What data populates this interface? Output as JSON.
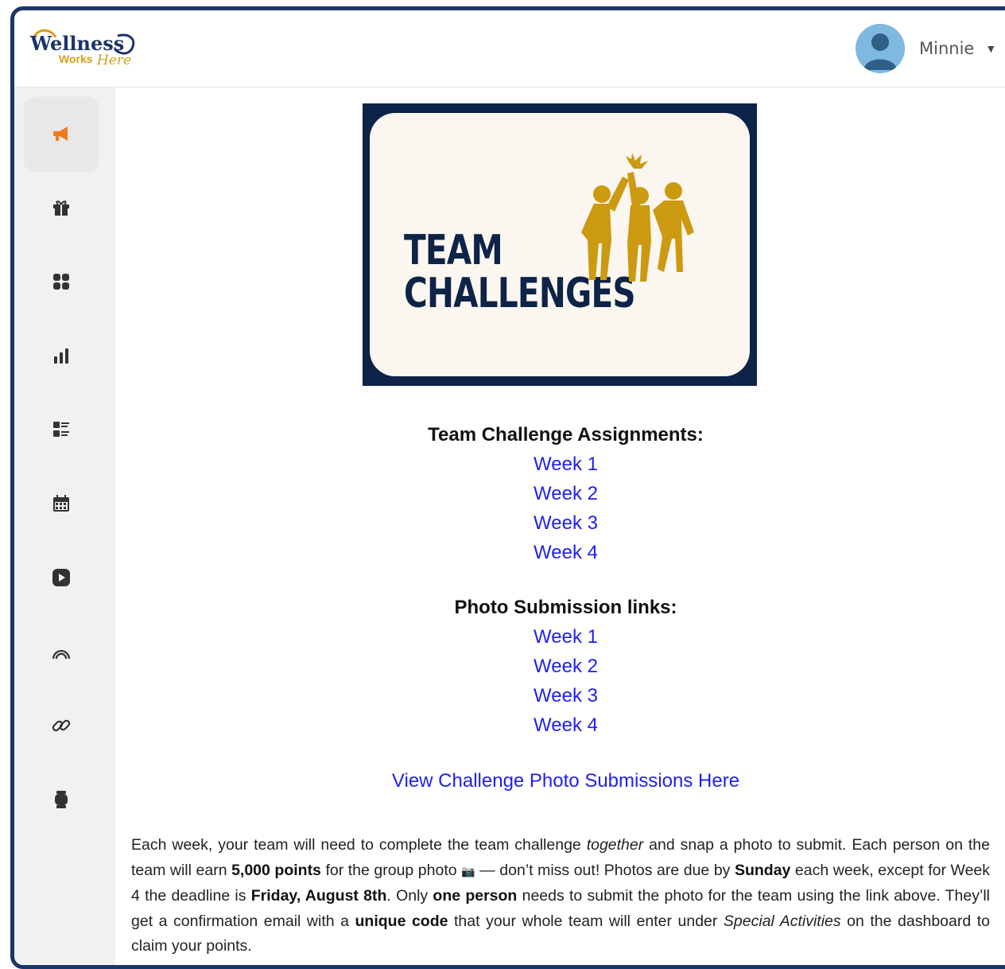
{
  "header": {
    "logo_text": "Wellness Works Here",
    "user_name": "Minnie",
    "caret": "▼"
  },
  "sidebar": {
    "items": [
      {
        "icon": "megaphone-icon",
        "active": true
      },
      {
        "icon": "gift-icon",
        "active": false
      },
      {
        "icon": "apps-grid-icon",
        "active": false
      },
      {
        "icon": "bar-chart-icon",
        "active": false
      },
      {
        "icon": "list-icon",
        "active": false
      },
      {
        "icon": "calendar-icon",
        "active": false
      },
      {
        "icon": "play-icon",
        "active": false
      },
      {
        "icon": "rainbow-icon",
        "active": false
      },
      {
        "icon": "link-icon",
        "active": false
      },
      {
        "icon": "watch-icon",
        "active": false
      }
    ]
  },
  "banner": {
    "line1": "TEAM",
    "line2": "CHALLENGES"
  },
  "assignments": {
    "heading": "Team Challenge Assignments:",
    "links": [
      "Week 1",
      "Week 2",
      "Week 3",
      "Week 4"
    ]
  },
  "photos": {
    "heading": "Photo Submission links:",
    "links": [
      "Week 1",
      "Week 2",
      "Week 3",
      "Week 4"
    ]
  },
  "view_link": "View Challenge Photo Submissions Here",
  "paragraph": {
    "t1": "Each week, your team will need to complete the team challenge ",
    "t2": "together",
    "t3": " and snap a photo to submit. Each person on the team will earn ",
    "t4": "5,000 points",
    "t5": " for the group photo ",
    "t6": "📷",
    "t7": " — don’t miss out! Photos are due by ",
    "t8": "Sunday",
    "t9": " each week, except for Week 4 the deadline is ",
    "t10": "Friday, August 8th",
    "t11": ". Only ",
    "t12": "one person",
    "t13": " needs to submit the photo for the team using the link above. They’ll get a confirmation email with a ",
    "t14": "unique code",
    "t15": " that your whole team will enter under ",
    "t16": "Special Activities",
    "t17": " on the dashboard to claim your points."
  },
  "colors": {
    "frame": "#1b3569",
    "link": "#1f1ff0",
    "banner_navy": "#0d2347",
    "banner_gold": "#cc9a10",
    "active_icon": "#f07a1a"
  }
}
